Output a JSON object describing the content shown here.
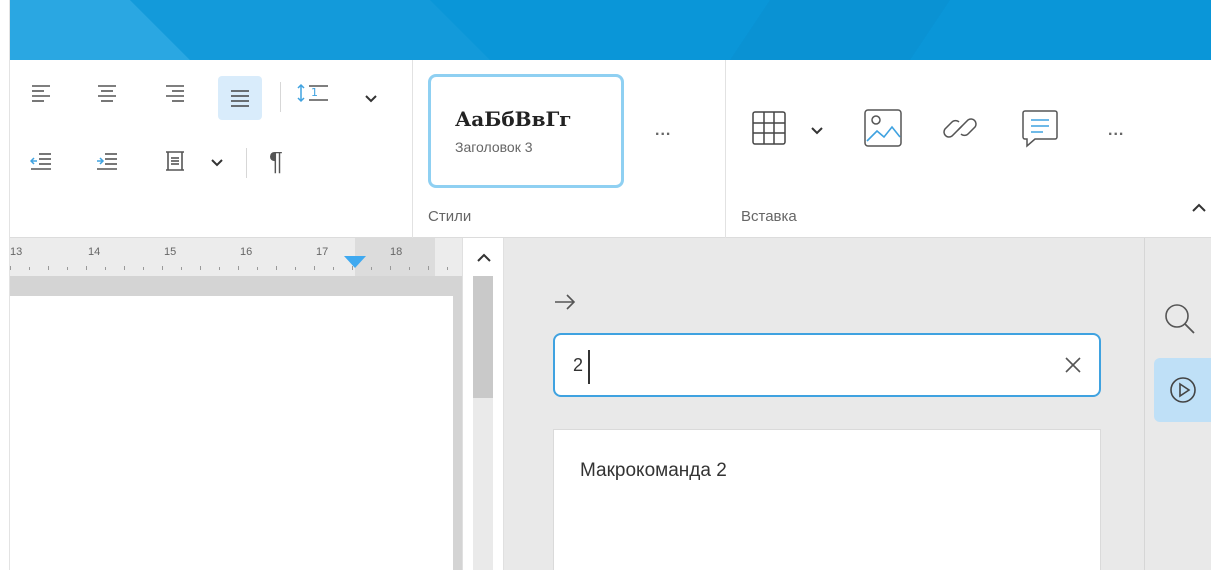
{
  "ribbon": {
    "styles_group": {
      "label": "Стили",
      "style_sample": "АаБбВвГг",
      "style_name": "Заголовок 3",
      "more": "..."
    },
    "insert_group": {
      "label": "Вставка",
      "more": "..."
    },
    "paragraph_mark": "¶"
  },
  "ruler": {
    "labels": [
      "13",
      "14",
      "15",
      "16",
      "17",
      "18"
    ]
  },
  "macro_panel": {
    "search_value": "2",
    "results": [
      "Макрокоманда 2"
    ]
  },
  "colors": {
    "accent": "#3fa2e0",
    "titlebar": "#0a96d8",
    "active_button": "#d9ecfb",
    "panel_bg": "#e9e9e9"
  },
  "icons": {
    "collapse": "chevron-up-icon",
    "panel_back": "arrow-right-icon",
    "clear": "close-icon",
    "side_search": "search-icon",
    "side_macro": "play-circle-icon"
  }
}
